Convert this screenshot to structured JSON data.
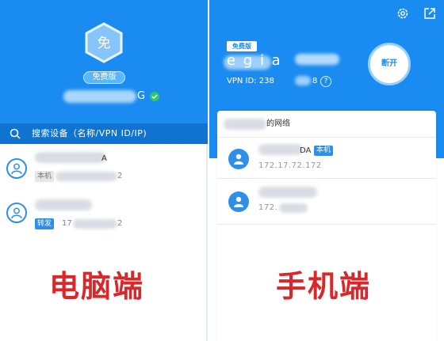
{
  "desktop": {
    "plan_badge": "免费版",
    "device_name_tail": "G",
    "avatar_char": "免",
    "search_placeholder": "搜索设备（名称/VPN ID/IP)",
    "devices": [
      {
        "name_fragment": "A",
        "tag": "本机",
        "ip_tail": "2"
      },
      {
        "name_fragment": "",
        "tag": "转发",
        "ip_prefix": "17",
        "ip_tail": "2"
      }
    ],
    "label": "电脑端"
  },
  "mobile": {
    "plan_badge": "免费版",
    "device_name_frag": "e  g i a",
    "vpn_id_label": "VPN ID: 238",
    "vpn_id_tail": "8",
    "disconnect_label": "断开",
    "network_name_frag": "的网络",
    "devices": [
      {
        "name_fragment": "DA",
        "tag": "本机",
        "ip": "172.17.72.172"
      },
      {
        "name_fragment": "",
        "ip_prefix": "172."
      }
    ],
    "label": "手机端"
  }
}
